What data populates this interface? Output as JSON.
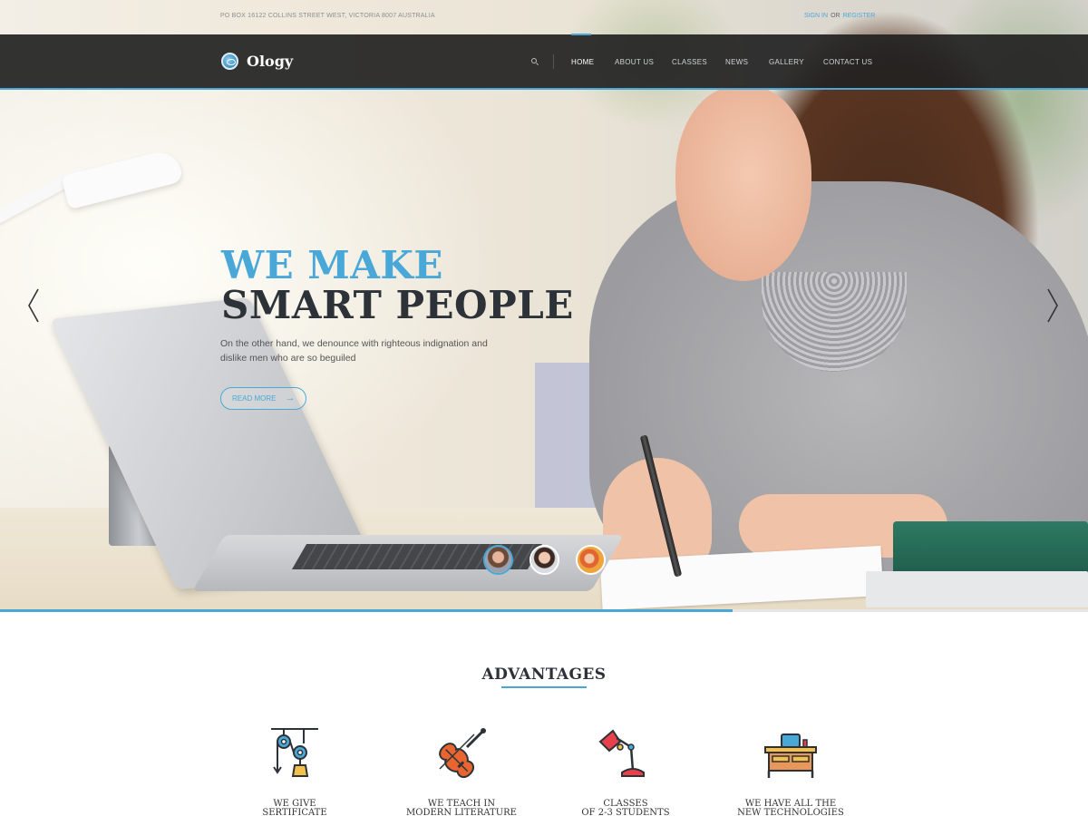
{
  "topbar": {
    "address": "PO BOX 16122 COLLINS STREET WEST, VICTORIA 8007 AUSTRALIA",
    "sign_in": "SIGN IN",
    "or": "OR",
    "register": "REGISTER"
  },
  "nav": {
    "logo_text": "Ology",
    "items": [
      {
        "label": "HOME",
        "active": true
      },
      {
        "label": "ABOUT US",
        "active": false
      },
      {
        "label": "CLASSES",
        "active": false
      },
      {
        "label": "NEWS",
        "active": false
      },
      {
        "label": "GALLERY",
        "active": false
      },
      {
        "label": "CONTACT US",
        "active": false
      }
    ]
  },
  "hero": {
    "title_line1": "WE MAKE",
    "title_line2": "SMART PEOPLE",
    "description": "On the other hand, we denounce with righteous indignation and dislike men who are so beguiled",
    "button_label": "READ MORE",
    "slide_progress": 0.673,
    "active_slide": 1,
    "slide_count": 3
  },
  "advantages": {
    "title": "ADVANTAGES",
    "items": [
      {
        "icon": "pulley-icon",
        "line1": "WE GIVE",
        "line2": "SERTIFICATE"
      },
      {
        "icon": "violin-icon",
        "line1": "WE TEACH IN",
        "line2": "MODERN LITERATURE"
      },
      {
        "icon": "desk-lamp-icon",
        "line1": "CLASSES",
        "line2": "OF 2-3 STUDENTS"
      },
      {
        "icon": "desk-icon",
        "line1": "WE HAVE ALL THE",
        "line2": "NEW TECHNOLOGIES"
      }
    ]
  },
  "colors": {
    "accent": "#4aa8d8",
    "nav_bg": "#222222",
    "heading_dark": "#2c3238"
  }
}
